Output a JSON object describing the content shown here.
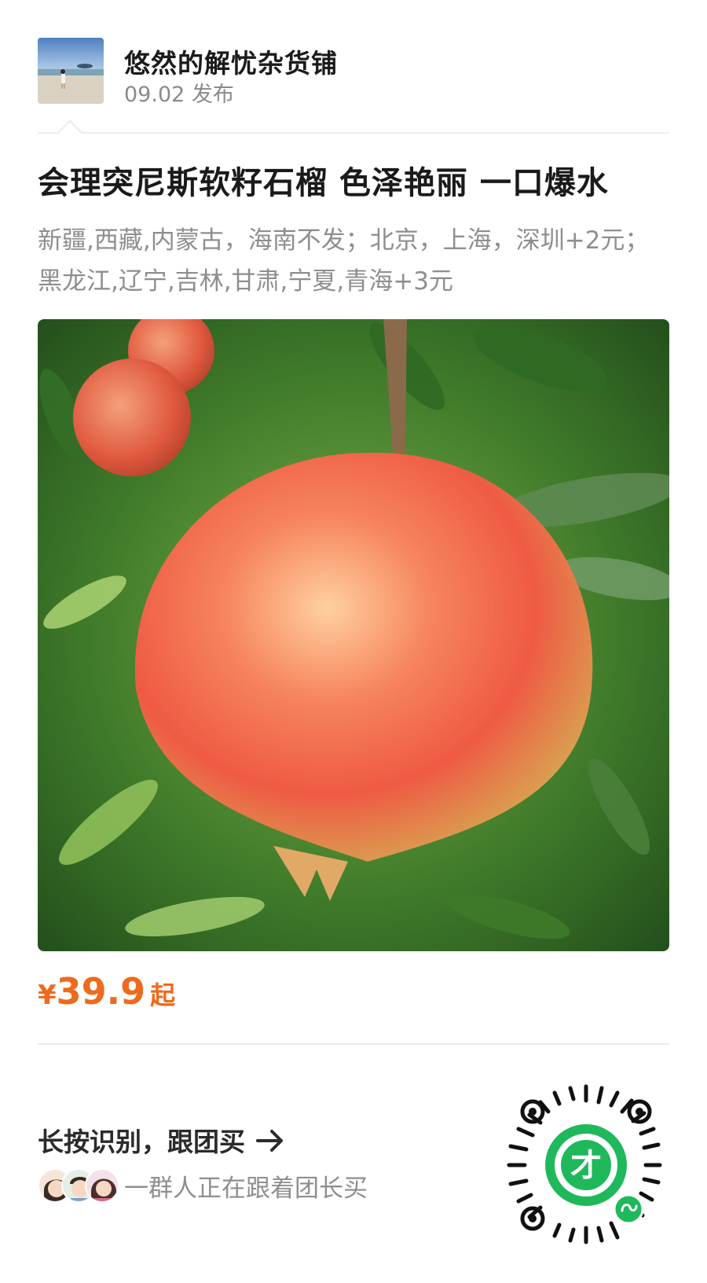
{
  "post": {
    "shop_name": "悠然的解忧杂货铺",
    "date": "09.02 发布"
  },
  "product": {
    "title": "会理突尼斯软籽石榴 色泽艳丽 一口爆水",
    "shipping_note": "新疆,西藏,内蒙古，海南不发；北京，上海，深圳+2元；黑龙江,辽宁,吉林,甘肃,宁夏,青海+3元",
    "price_currency": "¥",
    "price_value": "39.9",
    "price_suffix": "起"
  },
  "cta": {
    "label": "长按识别，跟团买",
    "buyers_text": "一群人正在跟着团长买"
  },
  "colors": {
    "price": "#ee6a1c",
    "qr_green": "#1fb85a"
  },
  "icons": {
    "arrow": "arrow-right-icon",
    "miniprogram": "mini-program-icon"
  }
}
